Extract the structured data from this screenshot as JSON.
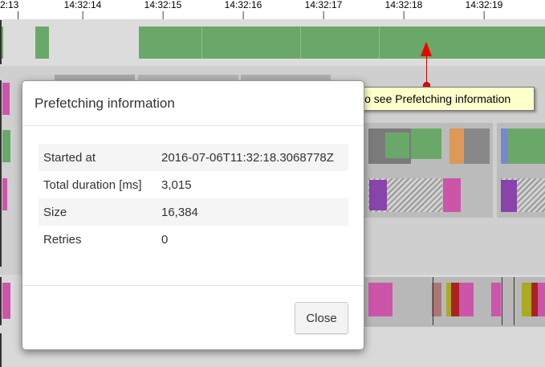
{
  "timeline": {
    "ticks": [
      "2:13",
      "14:32:14",
      "14:32:15",
      "14:32:16",
      "14:32:17",
      "14:32:18",
      "14:32:19"
    ]
  },
  "tooltip": {
    "text": "Click to see Prefetching information"
  },
  "dialog": {
    "title": "Prefetching information",
    "rows": [
      {
        "key": "Started at",
        "value": "2016-07-06T11:32:18.3068778Z"
      },
      {
        "key": "Total duration [ms]",
        "value": "3,015"
      },
      {
        "key": "Size",
        "value": "16,384"
      },
      {
        "key": "Retries",
        "value": "0"
      }
    ],
    "close_label": "Close"
  },
  "colors": {
    "prefetch_bar": "#6aa86a",
    "marker": "#ee0000",
    "tooltip_bg": "#ffffcc"
  }
}
